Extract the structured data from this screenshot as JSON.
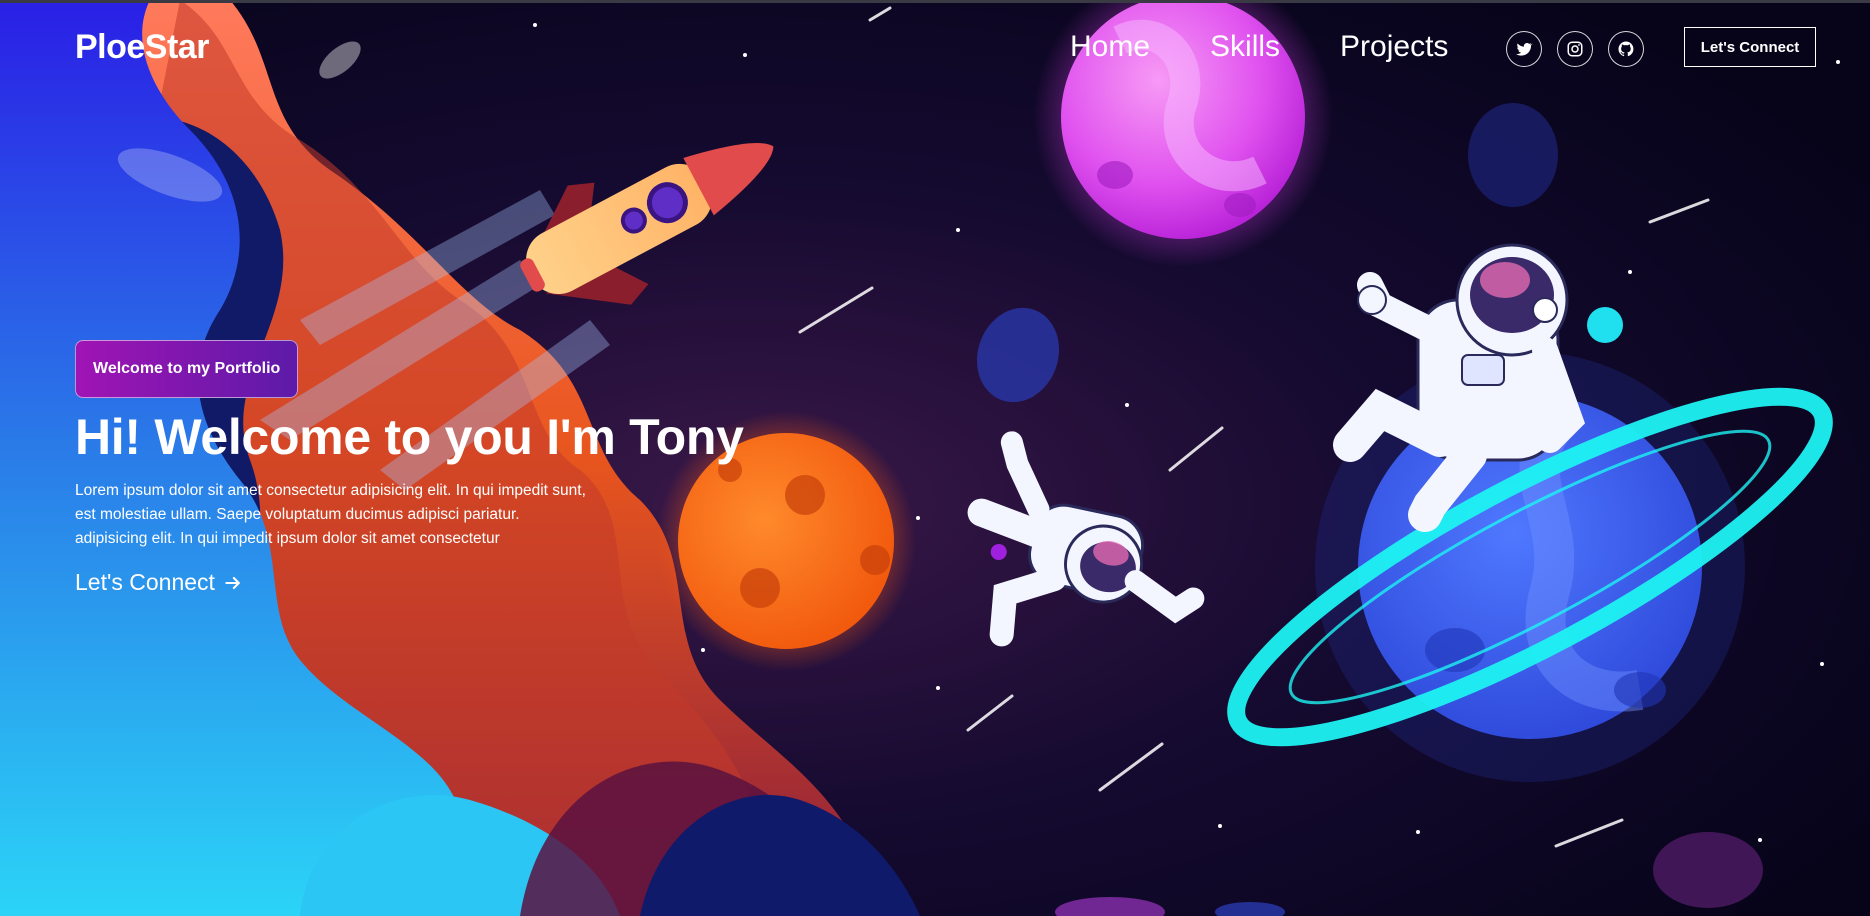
{
  "navbar": {
    "brand": "PloeStar",
    "links": [
      {
        "label": "Home"
      },
      {
        "label": "Skills"
      },
      {
        "label": "Projects"
      }
    ],
    "social": [
      {
        "icon": "twitter-icon"
      },
      {
        "icon": "instagram-icon"
      },
      {
        "icon": "github-icon"
      }
    ],
    "connect_label": "Let's Connect"
  },
  "hero": {
    "tagline": "Welcome to my Portfolio",
    "headline": "Hi! Welcome to you I'm Tony",
    "description": "Lorem ipsum dolor sit amet consectetur adipisicing elit. In qui impedit sunt, est molestiae ullam. Saepe voluptatum ducimus adipisci pariatur. adipisicing elit. In qui impedit ipsum dolor sit amet consectetur",
    "cta_label": "Let's Connect",
    "cta_icon": "arrow-right-icon"
  },
  "colors": {
    "background": "#0b0620",
    "tagline_gradient_start": "#a014b4",
    "tagline_gradient_end": "#5d1aa8",
    "text": "#ffffff"
  }
}
